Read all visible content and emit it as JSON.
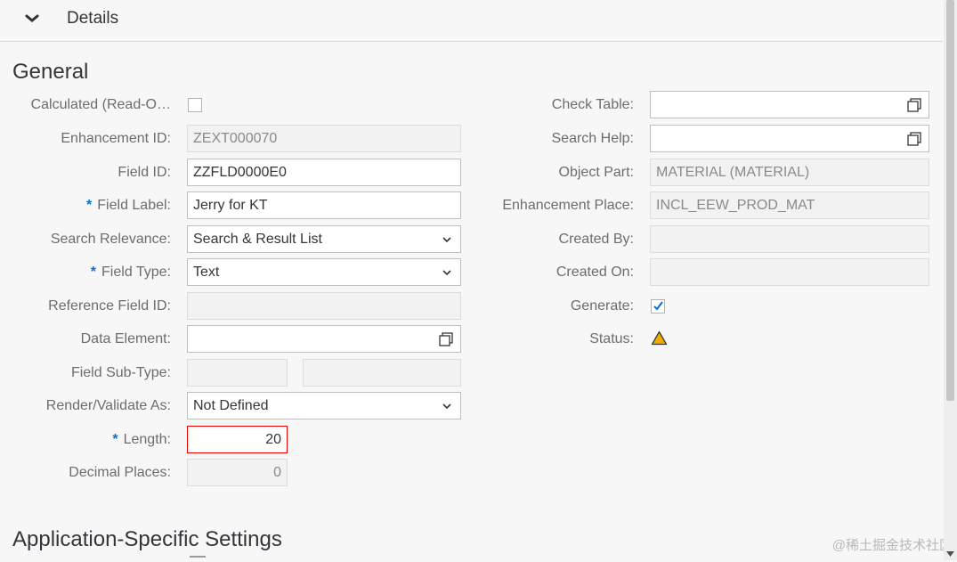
{
  "header": {
    "title": "Details"
  },
  "sections": {
    "general": "General",
    "app_specific": "Application-Specific Settings"
  },
  "left": {
    "calculated": {
      "label": "Calculated (Read-O…",
      "checked": false
    },
    "enhancement_id": {
      "label": "Enhancement ID:",
      "value": "ZEXT000070"
    },
    "field_id": {
      "label": "Field ID:",
      "value": "ZZFLD0000E0"
    },
    "field_label": {
      "label": "Field Label:",
      "value": "Jerry for KT",
      "required": "*"
    },
    "search_relevance": {
      "label": "Search Relevance:",
      "value": "Search & Result List"
    },
    "field_type": {
      "label": "Field Type:",
      "value": "Text",
      "required": "*"
    },
    "reference_field_id": {
      "label": "Reference Field ID:",
      "value": ""
    },
    "data_element": {
      "label": "Data Element:",
      "value": ""
    },
    "field_sub_type": {
      "label": "Field Sub-Type:",
      "value1": "",
      "value2": ""
    },
    "render_validate": {
      "label": "Render/Validate As:",
      "value": "Not Defined"
    },
    "length": {
      "label": "Length:",
      "value": "20",
      "required": "*"
    },
    "decimal_places": {
      "label": "Decimal Places:",
      "value": "0"
    }
  },
  "right": {
    "check_table": {
      "label": "Check Table:",
      "value": ""
    },
    "search_help": {
      "label": "Search Help:",
      "value": ""
    },
    "object_part": {
      "label": "Object Part:",
      "value": "MATERIAL (MATERIAL)"
    },
    "enhancement_place": {
      "label": "Enhancement Place:",
      "value": "INCL_EEW_PROD_MAT"
    },
    "created_by": {
      "label": "Created By:",
      "value": ""
    },
    "created_on": {
      "label": "Created On:",
      "value": ""
    },
    "generate": {
      "label": "Generate:",
      "checked": true
    },
    "status": {
      "label": "Status:",
      "icon": "warning-icon",
      "color": "#f0ab00"
    }
  },
  "watermark": "@稀土掘金技术社区",
  "colors": {
    "required": "#0a6ed1",
    "error": "#e00000",
    "checkmark": "#0a6ed1"
  }
}
